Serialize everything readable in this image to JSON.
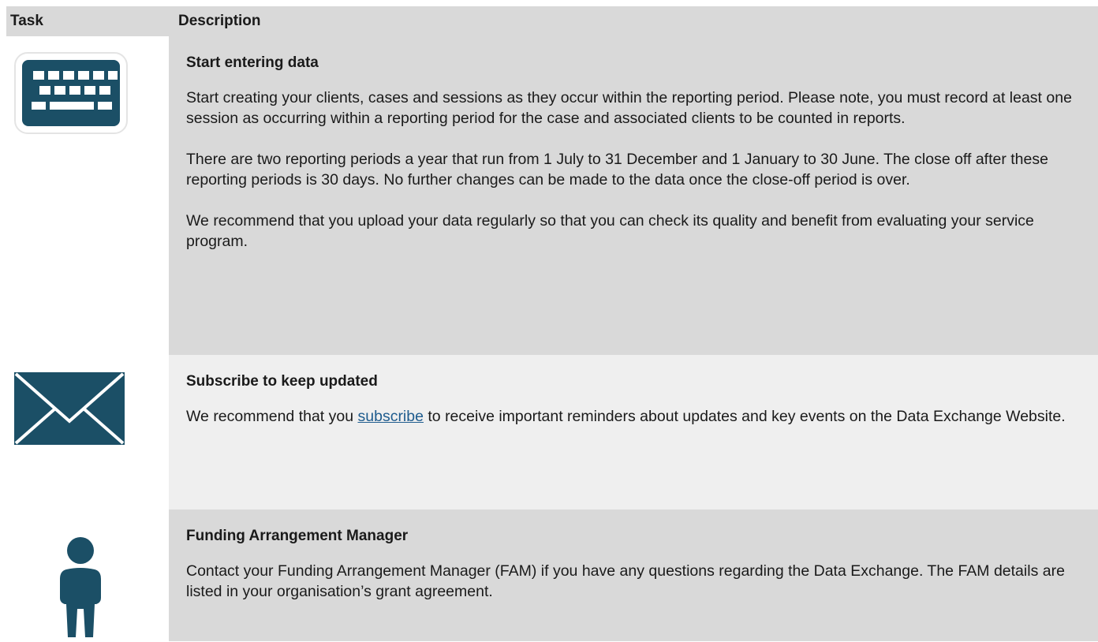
{
  "header": {
    "task_label": "Task",
    "description_label": "Description"
  },
  "rows": [
    {
      "icon": "keyboard-icon",
      "title": "Start entering data",
      "paragraphs": [
        "Start creating your clients, cases and sessions as they occur within the reporting period. Please note, you must record at least one session as occurring within a reporting period for the case and associated clients to be counted in reports.",
        "There are two reporting periods a year that run from 1 July to 31 December and 1 January to 30 June. The close off after these reporting periods is 30 days. No further changes can be made to the data once the close-off period is over.",
        "We recommend that you upload your data regularly so that you can check its quality and benefit from evaluating your service program."
      ]
    },
    {
      "icon": "envelope-icon",
      "title": "Subscribe to keep updated",
      "text_before_link": "We recommend that you ",
      "link_text": "subscribe",
      "text_after_link": " to receive important reminders about updates and key events on the Data Exchange Website."
    },
    {
      "icon": "person-icon",
      "title": "Funding Arrangement Manager",
      "paragraphs": [
        "Contact your Funding Arrangement Manager (FAM) if you have any questions regarding the Data Exchange. The FAM details are listed in your organisation’s grant agreement."
      ]
    }
  ],
  "colors": {
    "icon": "#1b4f66",
    "header_bg": "#d9d9d9",
    "row_gray": "#d9d9d9",
    "row_light": "#efefef",
    "link": "#1f5c8e"
  }
}
